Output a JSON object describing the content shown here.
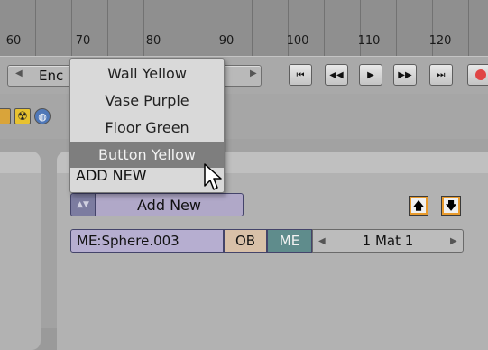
{
  "timeline": {
    "ticks": [
      "60",
      "70",
      "80",
      "90",
      "100",
      "110",
      "120"
    ]
  },
  "header": {
    "frame_field_label": "Enc"
  },
  "playback": {
    "icons": [
      "skip-to-start-icon",
      "rewind-icon",
      "play-icon",
      "fast-forward-icon",
      "skip-to-end-icon",
      "record-icon"
    ]
  },
  "toolbar_icons": [
    "radiation-icon",
    "globe-icon"
  ],
  "material_panel": {
    "add_new_button": "Add New",
    "mesh_link": "ME:Sphere.003",
    "ob_button": "OB",
    "me_button": "ME",
    "material_index": "1 Mat 1"
  },
  "dropdown": {
    "items": [
      "Wall Yellow",
      "Vase Purple",
      "Floor Green",
      "Button Yellow"
    ],
    "selected": "Button Yellow",
    "add_new": "ADD NEW"
  },
  "colors": {
    "record": "#e04545",
    "me_active": "#5f8c8c",
    "orange": "#e89a2c"
  }
}
